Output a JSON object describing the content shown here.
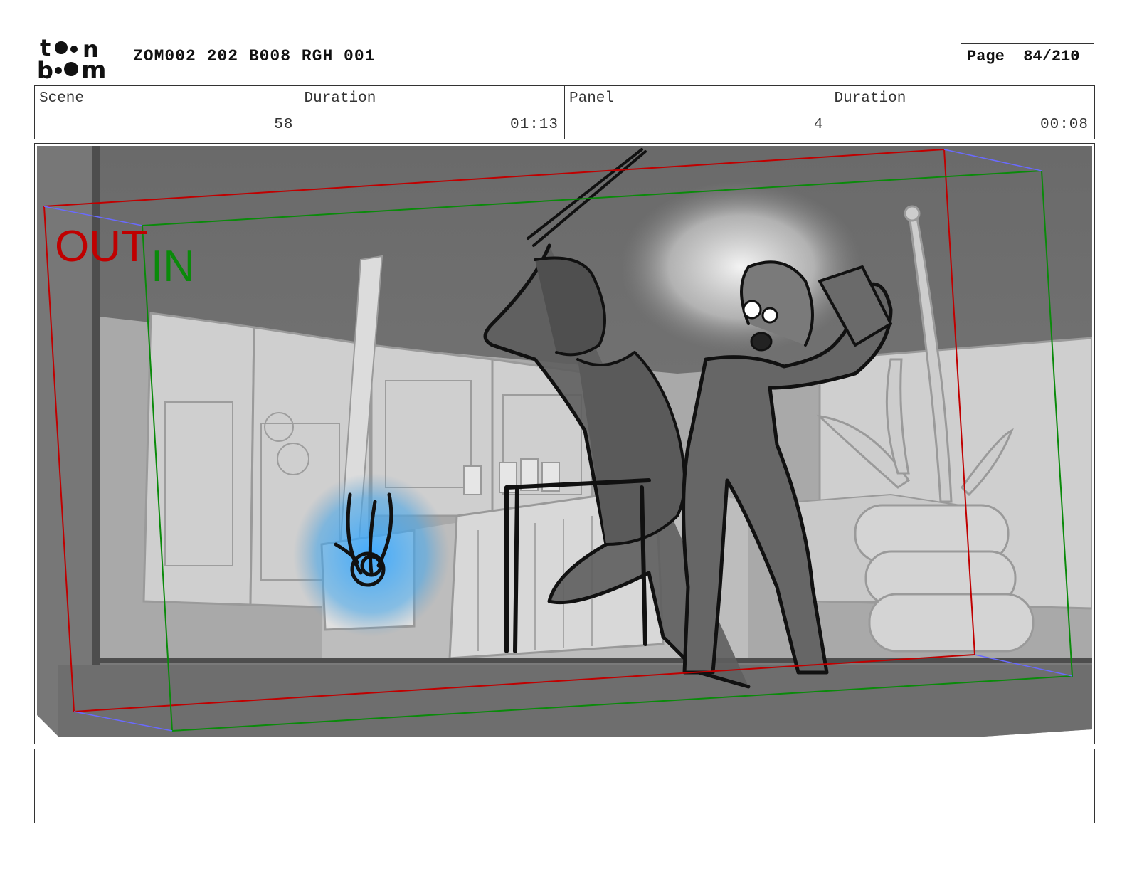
{
  "header": {
    "project_id": "ZOM002 202 B008 RGH 001",
    "page_label": "Page",
    "page_value": "84/210"
  },
  "info": {
    "scene_label": "Scene",
    "scene_value": "58",
    "scene_duration_label": "Duration",
    "scene_duration_value": "01:13",
    "panel_label": "Panel",
    "panel_value": "4",
    "panel_duration_label": "Duration",
    "panel_duration_value": "00:08"
  },
  "panel": {
    "out_label": "OUT",
    "in_label": "IN",
    "out_color": "#c00000",
    "in_color": "#0a8a0a"
  },
  "notes": {
    "text": ""
  }
}
